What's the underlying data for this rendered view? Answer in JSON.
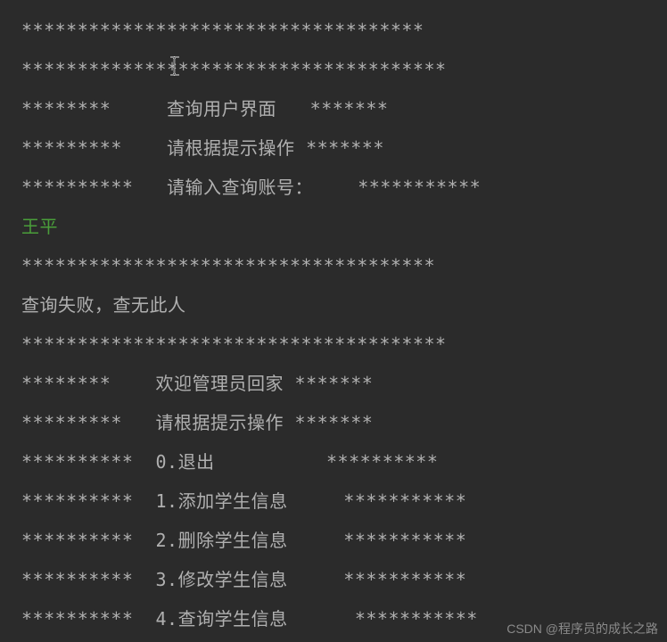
{
  "terminal": {
    "lines": [
      "************************************",
      "**************************************",
      "********     查询用户界面   *******",
      "*********    请根据提示操作 *******",
      "**********   请输入查询账号：    ***********"
    ],
    "userInput": "王平",
    "resultLines": [
      "*************************************",
      "查询失败，查无此人",
      "**************************************",
      "********    欢迎管理员回家 *******",
      "*********   请根据提示操作 *******",
      "**********  0.退出          **********",
      "**********  1.添加学生信息     ***********",
      "**********  2.删除学生信息     ***********",
      "**********  3.修改学生信息     ***********",
      "**********  4.查询学生信息      ***********"
    ]
  },
  "watermark": "CSDN @程序员的成长之路"
}
